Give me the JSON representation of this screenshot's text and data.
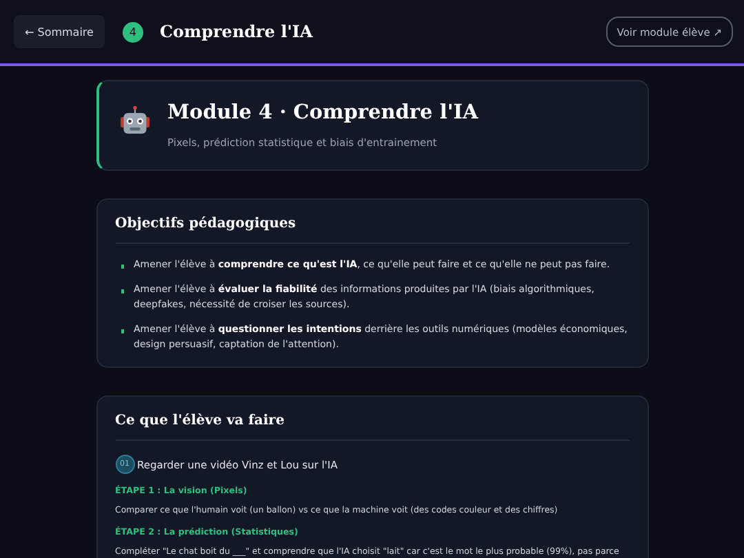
{
  "topbar": {
    "back_button": "← Sommaire",
    "module_number": "4",
    "title": "Comprendre l'IA",
    "student_button": "Voir module élève ↗"
  },
  "header": {
    "title": "Module 4 · Comprendre l'IA",
    "subtitle": "Pixels, prédiction statistique et biais d'entrainement"
  },
  "objectives": {
    "title": "Objectifs pédagogiques",
    "items": [
      "Amener l'élève à **comprendre ce qu'est l'IA**, ce qu'elle peut faire et ce qu'elle ne peut pas faire.",
      "Amener l'élève à **évaluer la fiabilité** des informations produites par l'IA (biais algorithmiques, deepfakes, nécessité de croiser les sources).",
      "Amener l'élève à **questionner les intentions** derrière les outils numériques (modèles économiques, design persuasif, captation de l'attention)."
    ]
  },
  "activities": {
    "title": "Ce que l'élève va faire",
    "steps": [
      {
        "number": "01",
        "label": "Regarder une vidéo Vinz et Lou sur l'IA"
      }
    ],
    "stages": [
      {
        "title": "ÉTAPE 1 : La vision (Pixels)",
        "text": "Comparer ce que l'humain voit (un ballon) vs ce que la machine voit (des codes couleur et des chiffres)"
      },
      {
        "title": "ÉTAPE 2 : La prédiction (Statistiques)",
        "text": "Compléter \"Le chat boit du ___\" et comprendre que l'IA choisit \"lait\" car c'est le mot le plus probable (99%), pas parce"
      }
    ]
  }
}
